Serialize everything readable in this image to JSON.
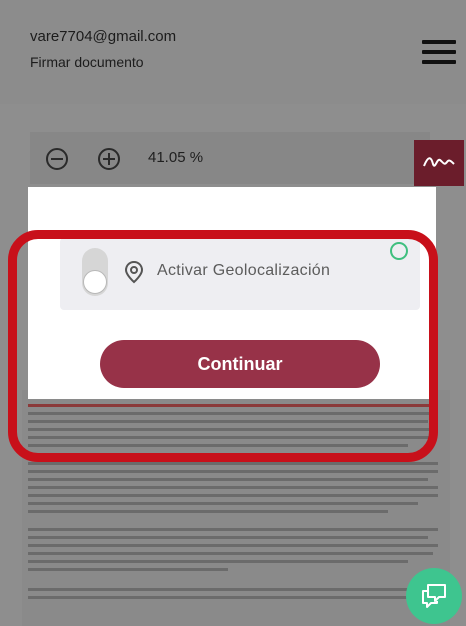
{
  "header": {
    "email": "vare7704@gmail.com",
    "subtitle": "Firmar documento",
    "menu_icon": "hamburger-menu-icon"
  },
  "toolbar": {
    "zoom_out_icon": "zoom-out-icon",
    "zoom_in_icon": "zoom-in-icon",
    "zoom_value": "41.05 %",
    "signature_icon": "signature-icon",
    "accent_color": "#6b1d2b"
  },
  "modal": {
    "geolocation_label": "Activar Geolocalización",
    "geolocation_enabled": false,
    "location_icon": "location-pin-icon",
    "continue_label": "Continuar",
    "button_color": "#973248"
  },
  "overlay": {
    "highlight_color": "#c8101a"
  },
  "fab": {
    "icon": "chat-icon",
    "color": "#3ec58f"
  }
}
